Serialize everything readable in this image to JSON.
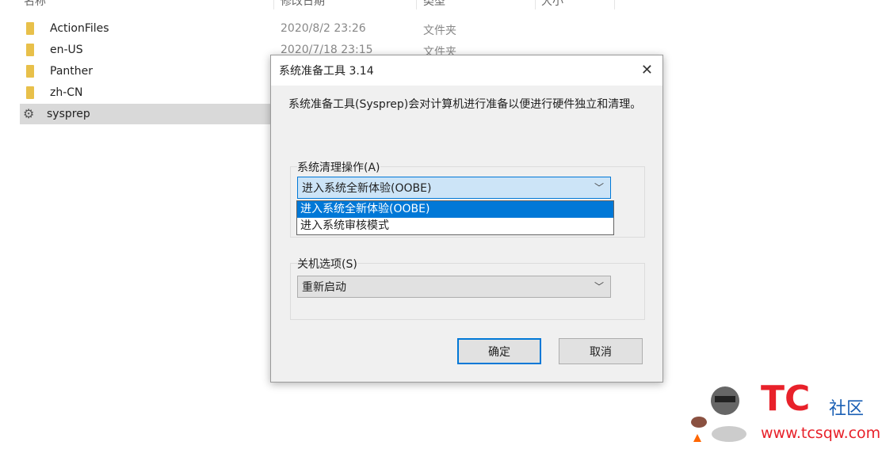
{
  "explorer": {
    "columns": [
      "名称",
      "修改日期",
      "类型",
      "大小"
    ],
    "files": [
      {
        "name": "ActionFiles",
        "date": "2020/8/2 23:26",
        "type": "文件夹",
        "icon": "folder-icon"
      },
      {
        "name": "en-US",
        "date": "2020/7/18 23:15",
        "type": "文件夹",
        "icon": "folder-icon"
      },
      {
        "name": "Panther",
        "icon": "folder-icon"
      },
      {
        "name": "zh-CN",
        "icon": "folder-icon"
      },
      {
        "name": "sysprep",
        "icon": "sysprep-app-icon",
        "selected": true
      }
    ]
  },
  "dialog": {
    "title": "系统准备工具 3.14",
    "close": "✕",
    "description": "系统准备工具(Sysprep)会对计算机进行准备以便进行硬件独立和清理。",
    "cleanup_label": "系统清理操作(A)",
    "cleanup_value": "进入系统全新体验(OOBE)",
    "cleanup_options": [
      "进入系统全新体验(OOBE)",
      "进入系统审核模式"
    ],
    "shutdown_label": "关机选项(S)",
    "shutdown_value": "重新启动",
    "ok": "确定",
    "cancel": "取消"
  },
  "watermark": {
    "brand": "TC",
    "suffix": "社区",
    "url": "www.tcsqw.com",
    "colors": {
      "red": "#e8212a",
      "blue": "#1a5fb4"
    }
  }
}
